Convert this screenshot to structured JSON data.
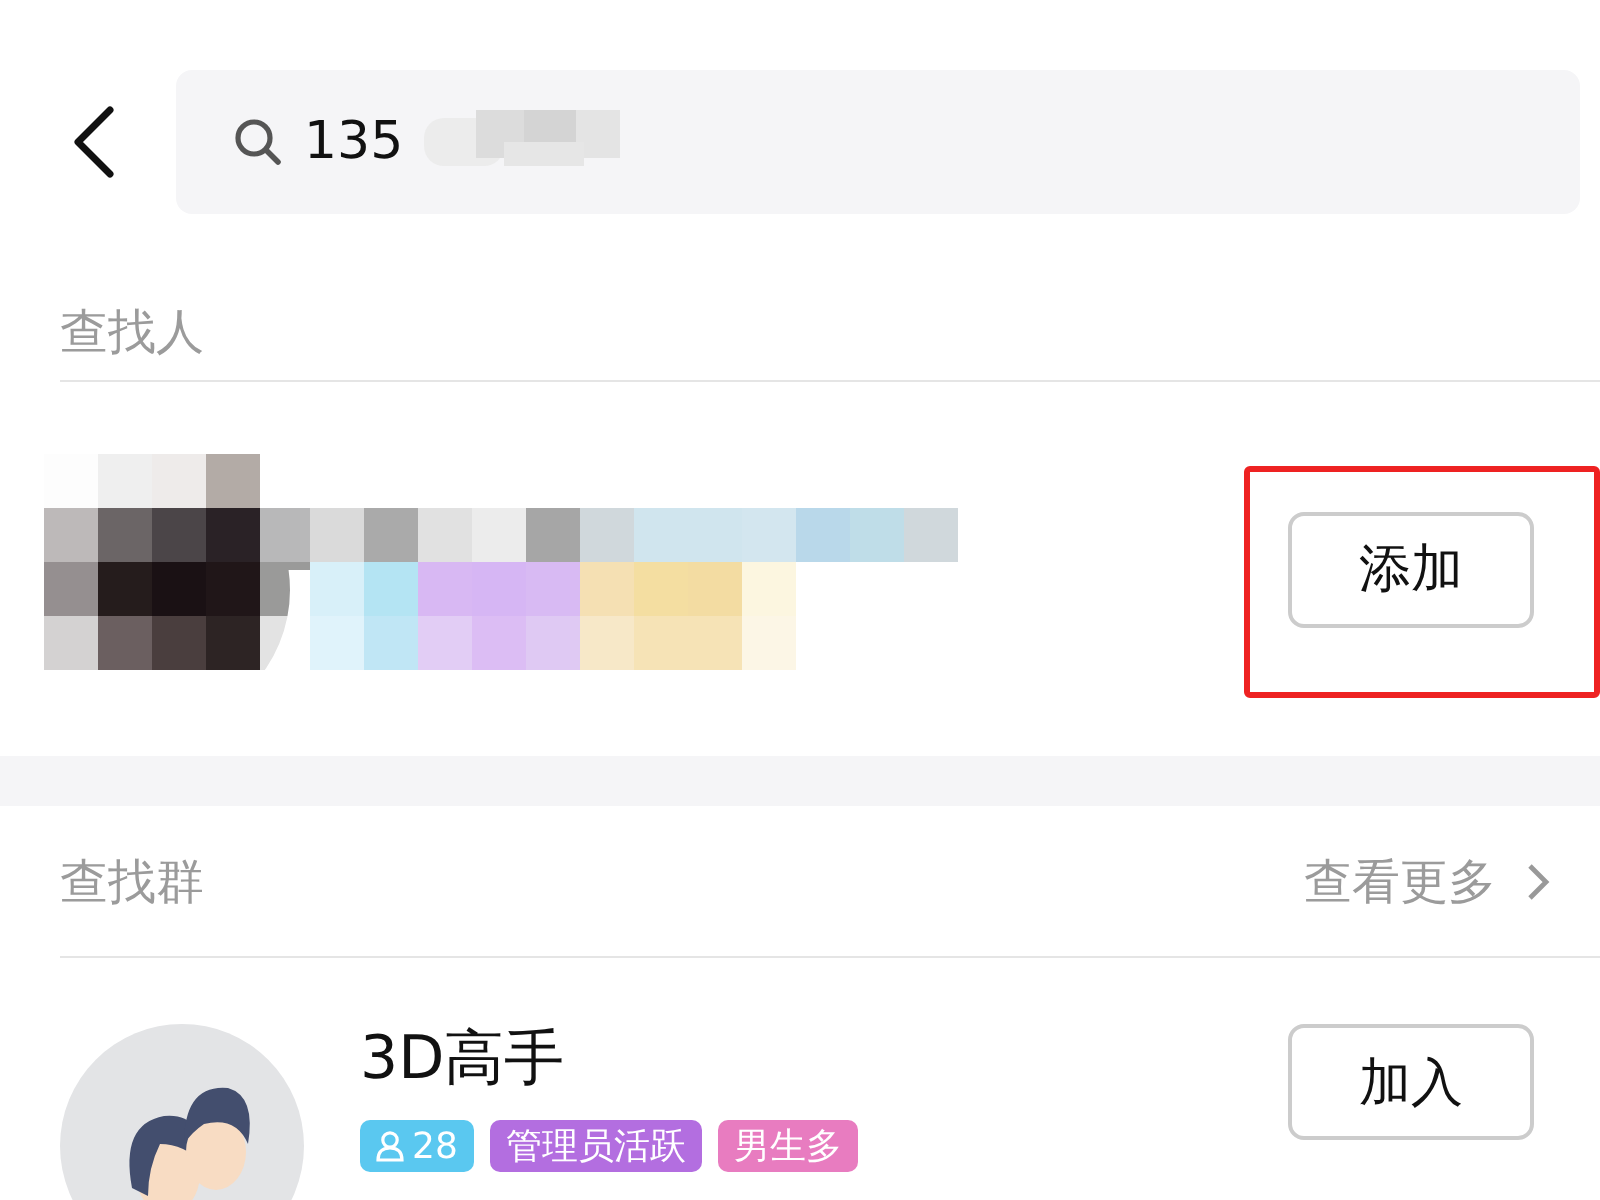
{
  "search": {
    "value": "135"
  },
  "people_section": {
    "title": "查找人",
    "result": {
      "add_button": "添加",
      "highlighted": true
    }
  },
  "group_section": {
    "title": "查找群",
    "more_link": "查看更多",
    "groups": [
      {
        "name": "3D高手",
        "member_count": "28",
        "tags": [
          {
            "label": "管理员活跃",
            "color": "#b36ee0"
          },
          {
            "label": "男生多",
            "color": "#e87cc0"
          }
        ],
        "join_button": "加入"
      }
    ]
  }
}
